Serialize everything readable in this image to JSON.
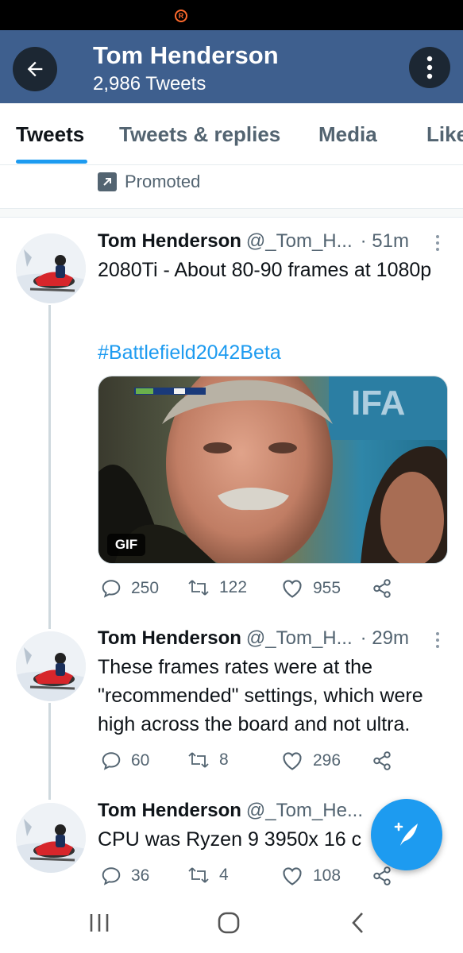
{
  "colors": {
    "header_bg": "#3e5f8e",
    "accent": "#1d9bf0",
    "muted_text": "#536471"
  },
  "header": {
    "name": "Tom Henderson",
    "tweet_count": "2,986 Tweets",
    "back_icon": "arrow-left-icon",
    "more_icon": "more-vertical-icon"
  },
  "tabs": [
    {
      "label": "Tweets",
      "active": true
    },
    {
      "label": "Tweets & replies",
      "active": false
    },
    {
      "label": "Media",
      "active": false
    },
    {
      "label": "Likes",
      "active": false
    }
  ],
  "promoted": {
    "label": "Promoted",
    "icon": "promoted-arrow-icon"
  },
  "tweets": [
    {
      "name": "Tom Henderson",
      "handle": "@_Tom_H...",
      "time": "· 51m",
      "text": "2080Ti - About 80-90 frames at 1080p",
      "hashtag": "#Battlefield2042Beta",
      "media": {
        "type": "gif",
        "badge": "GIF"
      },
      "replies": "250",
      "retweets": "122",
      "likes": "955"
    },
    {
      "name": "Tom Henderson",
      "handle": "@_Tom_H...",
      "time": "· 29m",
      "text": "These frames rates were at the \"recommended\" settings, which were high across the board and not ultra.",
      "replies": "60",
      "retweets": "8",
      "likes": "296"
    },
    {
      "name": "Tom Henderson",
      "handle": "@_Tom_He...",
      "time": "",
      "text": "CPU was Ryzen 9 3950x 16 c",
      "replies": "36",
      "retweets": "4",
      "likes": "108"
    }
  ],
  "fab": {
    "icon": "compose-tweet-icon"
  },
  "navbar": {
    "icons": [
      "recent-apps-icon",
      "home-icon",
      "back-icon"
    ]
  }
}
